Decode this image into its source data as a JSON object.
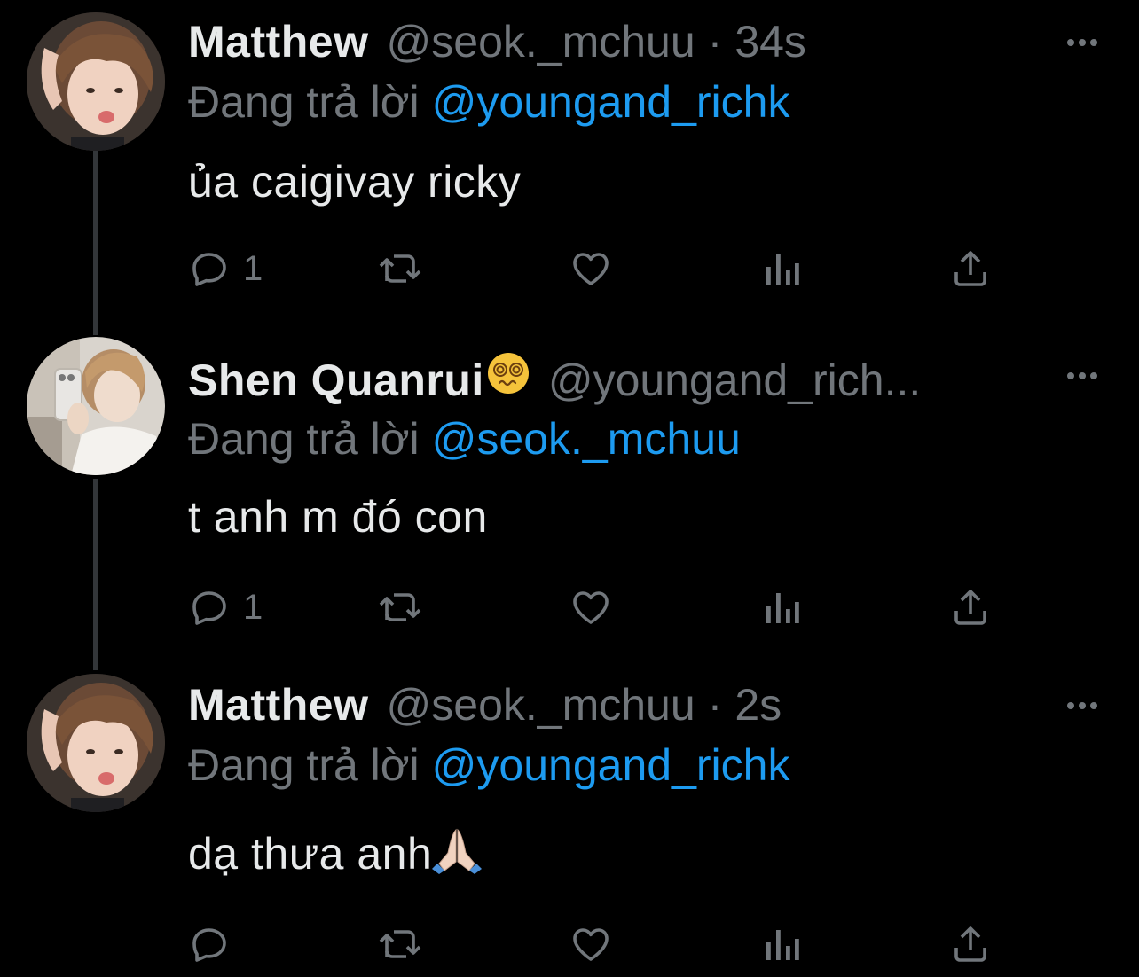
{
  "colors": {
    "background": "#000000",
    "text_primary": "#e7e9ea",
    "text_secondary": "#71767b",
    "accent": "#1d9bf0",
    "thread_line": "#333639"
  },
  "tweets": [
    {
      "author_name": "Matthew",
      "author_handle": "@seok._mchuu",
      "separator": "·",
      "timestamp": "34s",
      "reply_prefix": "Đang trả lời",
      "reply_to": "@youngand_richk",
      "text": "ủa caigivay ricky",
      "reply_count": "1",
      "icons": [
        "reply-icon",
        "retweet-icon",
        "like-icon",
        "analytics-icon",
        "share-icon",
        "more-icon"
      ]
    },
    {
      "author_name": "Shen Quanrui",
      "name_emoji": "dizzy-face-emoji",
      "author_handle": "@youngand_rich...",
      "reply_prefix": "Đang trả lời",
      "reply_to": "@seok._mchuu",
      "text": "t anh m đó con",
      "reply_count": "1",
      "icons": [
        "reply-icon",
        "retweet-icon",
        "like-icon",
        "analytics-icon",
        "share-icon",
        "more-icon"
      ]
    },
    {
      "author_name": "Matthew",
      "author_handle": "@seok._mchuu",
      "separator": "·",
      "timestamp": "2s",
      "reply_prefix": "Đang trả lời",
      "reply_to": "@youngand_richk",
      "text": "dạ thưa anh",
      "text_emoji": "folded-hands-emoji",
      "reply_count": "",
      "icons": [
        "reply-icon",
        "retweet-icon",
        "like-icon",
        "analytics-icon",
        "share-icon",
        "more-icon"
      ]
    }
  ]
}
